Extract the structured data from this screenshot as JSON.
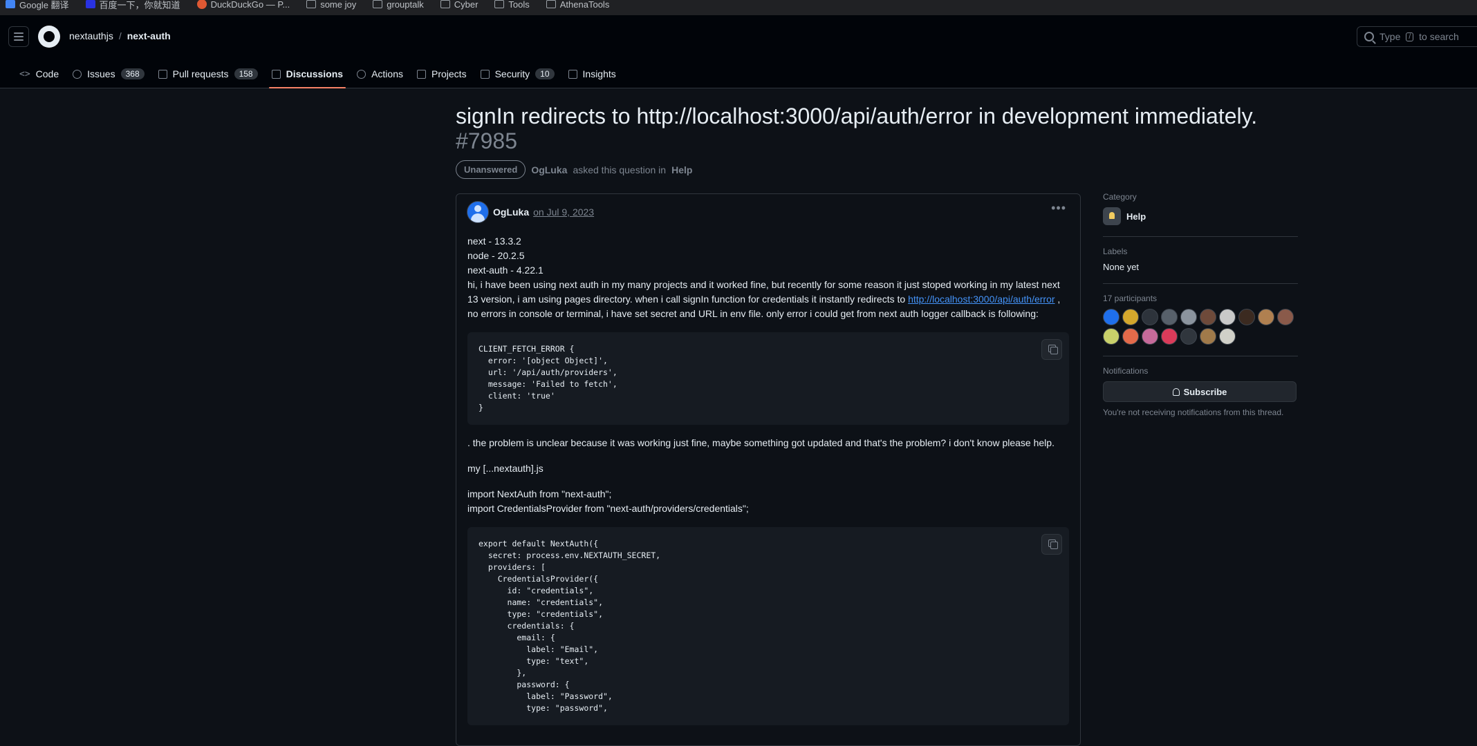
{
  "bookmarks": [
    {
      "label": "Google 翻译",
      "icon": "google-translate-icon"
    },
    {
      "label": "百度一下，你就知道",
      "icon": "baidu-icon"
    },
    {
      "label": "DuckDuckGo — P...",
      "icon": "duckduckgo-icon"
    },
    {
      "label": "some joy",
      "icon": "folder-icon"
    },
    {
      "label": "grouptalk",
      "icon": "folder-icon"
    },
    {
      "label": "Cyber",
      "icon": "folder-icon"
    },
    {
      "label": "Tools",
      "icon": "folder-icon"
    },
    {
      "label": "AthenaTools",
      "icon": "folder-icon"
    }
  ],
  "header": {
    "owner": "nextauthjs",
    "separator": "/",
    "repo": "next-auth",
    "search_prefix": "Type",
    "search_key": "/",
    "search_suffix": "to search"
  },
  "nav": {
    "code": "Code",
    "issues": "Issues",
    "issues_count": "368",
    "pulls": "Pull requests",
    "pulls_count": "158",
    "discussions": "Discussions",
    "actions": "Actions",
    "projects": "Projects",
    "security": "Security",
    "security_count": "10",
    "insights": "Insights"
  },
  "discussion": {
    "title": "signIn redirects to http://localhost:3000/api/auth/error in development immediately.",
    "number": "#7985",
    "status": "Unanswered",
    "asker": "OgLuka",
    "asked_text": "asked this question in",
    "category": "Help"
  },
  "post": {
    "author": "OgLuka",
    "date": "on Jul 9, 2023",
    "lines": [
      "next - 13.3.2",
      "node - 20.2.5",
      "next-auth - 4.22.1"
    ],
    "para1_a": "hi, i have been using next auth in my many projects and it worked fine, but recently for some reason it just stoped working in my latest next 13 version, i am using pages directory. when i call signIn function for credentials it instantly redirects to",
    "para1_link": "http://localhost:3000/api/auth/error",
    "para1_b": ", no errors in console or terminal, i have set secret and URL in env file. only error i could get from next auth logger callback is following:",
    "code1": "CLIENT_FETCH_ERROR {\n  error: '[object Object]',\n  url: '/api/auth/providers',\n  message: 'Failed to fetch',\n  client: 'true'\n}",
    "para2": ". the problem is unclear because it was working just fine, maybe something got updated and that's the problem? i don't know please help.",
    "para3": "my [...nextauth].js",
    "import1": "import NextAuth from \"next-auth\";",
    "import2": "import CredentialsProvider from \"next-auth/providers/credentials\";",
    "code2": "export default NextAuth({\n  secret: process.env.NEXTAUTH_SECRET,\n  providers: [\n    CredentialsProvider({\n      id: \"credentials\",\n      name: \"credentials\",\n      type: \"credentials\",\n      credentials: {\n        email: {\n          label: \"Email\",\n          type: \"text\",\n        },\n        password: {\n          label: \"Password\",\n          type: \"password\","
  },
  "sidebar": {
    "category_title": "Category",
    "category": "Help",
    "labels_title": "Labels",
    "labels_value": "None yet",
    "participants_title": "17 participants",
    "participant_colors": [
      "#1f6feb",
      "#d4a72c",
      "#2d333b",
      "#57606a",
      "#8b949e",
      "#6e4a3a",
      "#c9c9c9",
      "#3b2a20",
      "#b08050",
      "#8a5a4a",
      "#c8d06a",
      "#e36a4a",
      "#c66a9a",
      "#da3b5a",
      "#30363d",
      "#a07a4a",
      "#d0d0c8"
    ],
    "notifications_title": "Notifications",
    "subscribe": "Subscribe",
    "not_receiving": "You're not receiving notifications from this thread."
  }
}
